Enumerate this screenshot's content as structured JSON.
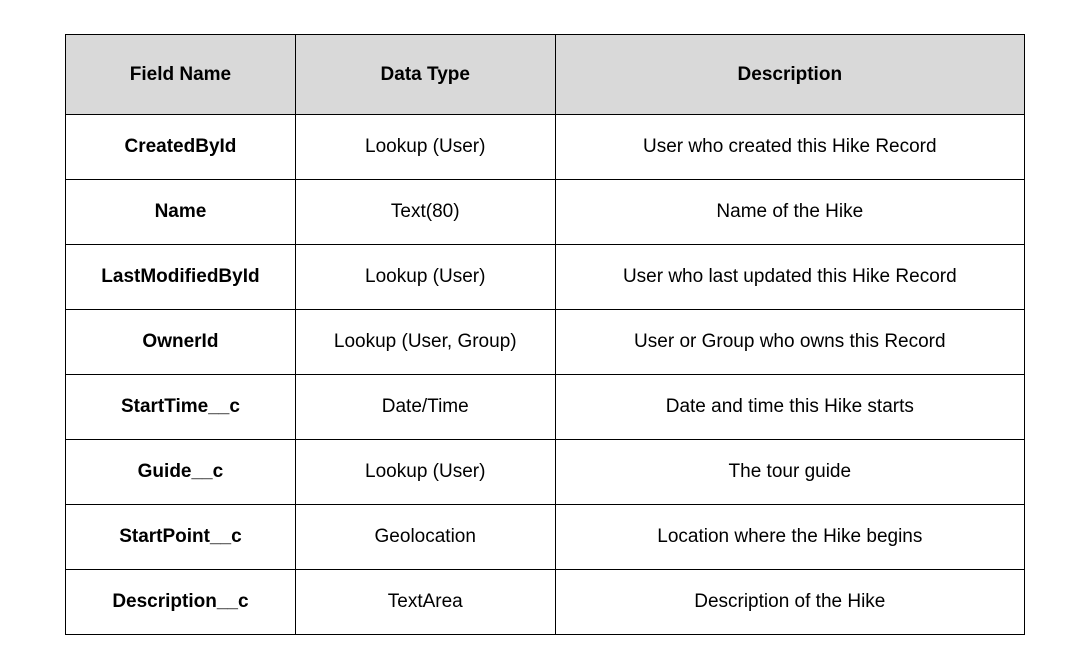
{
  "chart_data": {
    "type": "table",
    "title": "",
    "columns": [
      "Field Name",
      "Data Type",
      "Description"
    ],
    "rows": [
      [
        "CreatedById",
        "Lookup (User)",
        "User who created this Hike Record"
      ],
      [
        "Name",
        "Text(80)",
        "Name of the Hike"
      ],
      [
        "LastModifiedById",
        "Lookup (User)",
        "User who last updated this Hike Record"
      ],
      [
        "OwnerId",
        "Lookup (User, Group)",
        "User or Group who owns this Record"
      ],
      [
        "StartTime__c",
        "Date/Time",
        "Date and time this Hike starts"
      ],
      [
        "Guide__c",
        "Lookup (User)",
        "The tour guide"
      ],
      [
        "StartPoint__c",
        "Geolocation",
        "Location where the Hike begins"
      ],
      [
        "Description__c",
        "TextArea",
        "Description of the Hike"
      ]
    ]
  },
  "headers": {
    "field_name": "Field Name",
    "data_type": "Data Type",
    "description": "Description"
  },
  "rows": [
    {
      "field_name": "CreatedById",
      "data_type": "Lookup (User)",
      "description": "User who created this Hike Record"
    },
    {
      "field_name": "Name",
      "data_type": "Text(80)",
      "description": "Name of the Hike"
    },
    {
      "field_name": "LastModifiedById",
      "data_type": "Lookup (User)",
      "description": "User who last updated this Hike Record"
    },
    {
      "field_name": "OwnerId",
      "data_type": "Lookup (User, Group)",
      "description": "User or Group who owns this Record"
    },
    {
      "field_name": "StartTime__c",
      "data_type": "Date/Time",
      "description": "Date and time this Hike starts"
    },
    {
      "field_name": "Guide__c",
      "data_type": "Lookup (User)",
      "description": "The tour guide"
    },
    {
      "field_name": "StartPoint__c",
      "data_type": "Geolocation",
      "description": "Location where the Hike begins"
    },
    {
      "field_name": "Description__c",
      "data_type": "TextArea",
      "description": "Description of the Hike"
    }
  ]
}
